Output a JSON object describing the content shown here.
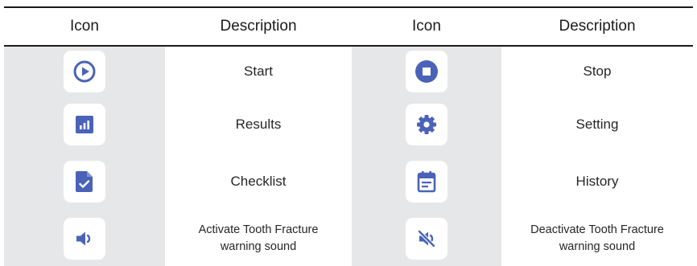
{
  "colors": {
    "icon": "#4a63b8",
    "icon_column_bg": "#e6e7e9",
    "rule": "#1a1a1a"
  },
  "header": {
    "icon1": "Icon",
    "desc1": "Description",
    "icon2": "Icon",
    "desc2": "Description"
  },
  "rows": [
    {
      "left": {
        "icon": "play-circle-icon",
        "label": "Start"
      },
      "right": {
        "icon": "stop-circle-icon",
        "label": "Stop"
      }
    },
    {
      "left": {
        "icon": "bar-chart-icon",
        "label": "Results"
      },
      "right": {
        "icon": "gear-icon",
        "label": "Setting"
      }
    },
    {
      "left": {
        "icon": "checklist-document-icon",
        "label": "Checklist"
      },
      "right": {
        "icon": "calendar-icon",
        "label": "History"
      }
    },
    {
      "left": {
        "icon": "speaker-on-icon",
        "label_line1": "Activate Tooth Fracture",
        "label_line2": "warning sound"
      },
      "right": {
        "icon": "speaker-muted-icon",
        "label_line1": "Deactivate Tooth Fracture",
        "label_line2": "warning sound"
      }
    }
  ]
}
